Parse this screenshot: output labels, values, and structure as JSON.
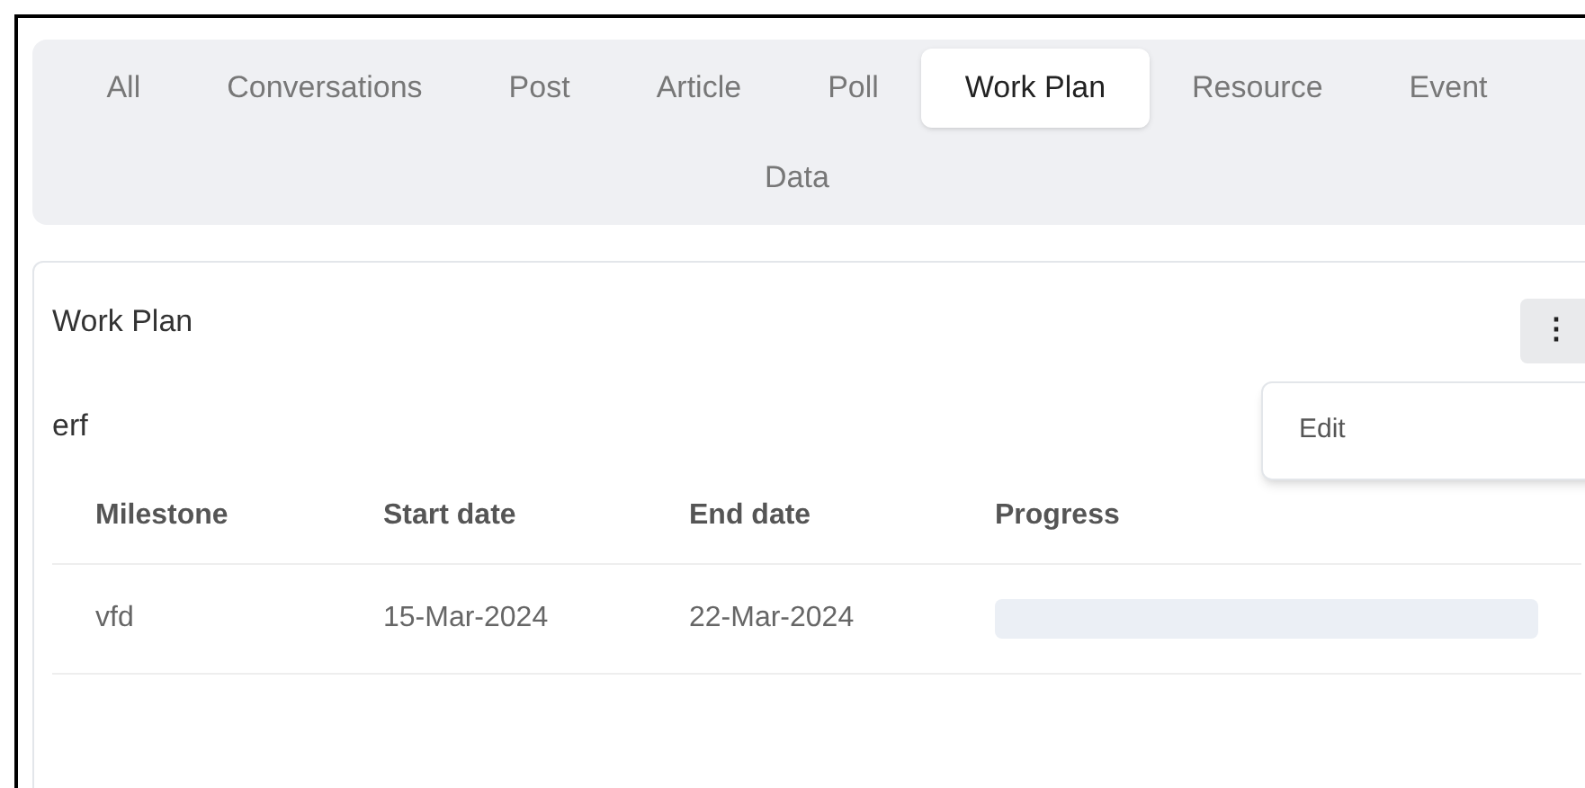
{
  "tabs": [
    {
      "label": "All",
      "selected": false
    },
    {
      "label": "Conversations",
      "selected": false
    },
    {
      "label": "Post",
      "selected": false
    },
    {
      "label": "Article",
      "selected": false
    },
    {
      "label": "Poll",
      "selected": false
    },
    {
      "label": "Work Plan",
      "selected": true
    },
    {
      "label": "Resource",
      "selected": false
    },
    {
      "label": "Event",
      "selected": false
    },
    {
      "label": "Data",
      "selected": false
    }
  ],
  "card": {
    "title": "Work Plan",
    "menu_icon": "⋮",
    "menu": [
      "Edit"
    ],
    "description": "erf",
    "table": {
      "columns": [
        "Milestone",
        "Start date",
        "End date",
        "Progress"
      ],
      "rows": [
        {
          "milestone": "vfd",
          "start": "15-Mar-2024",
          "end": "22-Mar-2024",
          "level": 0
        }
      ]
    }
  }
}
